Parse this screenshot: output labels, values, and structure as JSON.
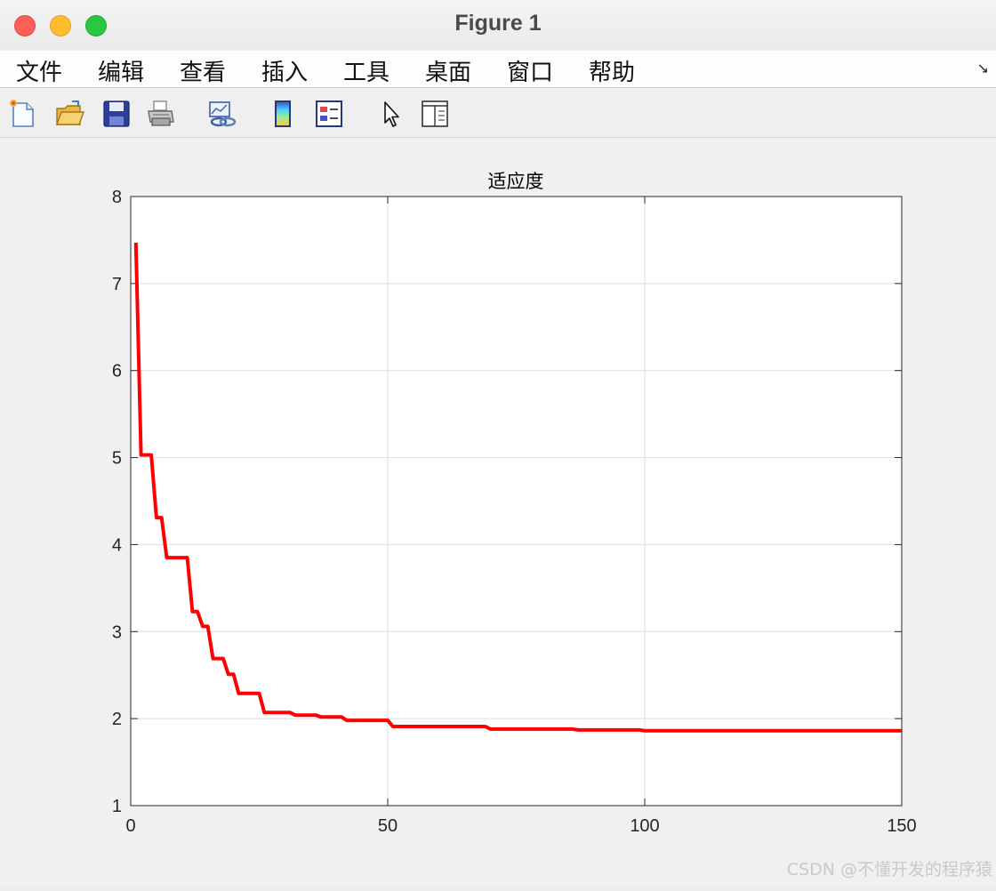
{
  "window": {
    "title": "Figure 1"
  },
  "menu": {
    "items": [
      {
        "label": "文件"
      },
      {
        "label": "编辑"
      },
      {
        "label": "查看"
      },
      {
        "label": "插入"
      },
      {
        "label": "工具"
      },
      {
        "label": "桌面"
      },
      {
        "label": "窗口"
      },
      {
        "label": "帮助"
      }
    ],
    "dock_glyph": "↘"
  },
  "toolbar": {
    "icons": [
      "new-figure-icon",
      "open-file-icon",
      "save-icon",
      "print-icon",
      "link-plot-icon",
      "colorbar-icon",
      "legend-icon",
      "edit-plot-pointer-icon",
      "property-inspector-icon"
    ]
  },
  "watermark": "CSDN @不懂开发的程序猿",
  "chart_data": {
    "type": "line",
    "title": "适应度",
    "xlabel": "",
    "ylabel": "",
    "xlim": [
      0,
      150
    ],
    "ylim": [
      1,
      8
    ],
    "xticks": [
      0,
      50,
      100,
      150
    ],
    "yticks": [
      1,
      2,
      3,
      4,
      5,
      6,
      7,
      8
    ],
    "grid": true,
    "series": [
      {
        "color": "#ff0000",
        "x": [
          1,
          2,
          4,
          5,
          6,
          7,
          11,
          12,
          13,
          14,
          15,
          16,
          18,
          19,
          20,
          21,
          25,
          26,
          31,
          32,
          36,
          37,
          41,
          42,
          50,
          51,
          69,
          70,
          86,
          87,
          99,
          100,
          150
        ],
        "y": [
          7.47,
          5.03,
          5.03,
          4.31,
          4.31,
          3.85,
          3.85,
          3.23,
          3.23,
          3.06,
          3.06,
          2.69,
          2.69,
          2.51,
          2.51,
          2.29,
          2.29,
          2.07,
          2.07,
          2.04,
          2.04,
          2.02,
          2.02,
          1.98,
          1.98,
          1.91,
          1.91,
          1.88,
          1.88,
          1.87,
          1.87,
          1.86,
          1.86
        ]
      }
    ]
  }
}
